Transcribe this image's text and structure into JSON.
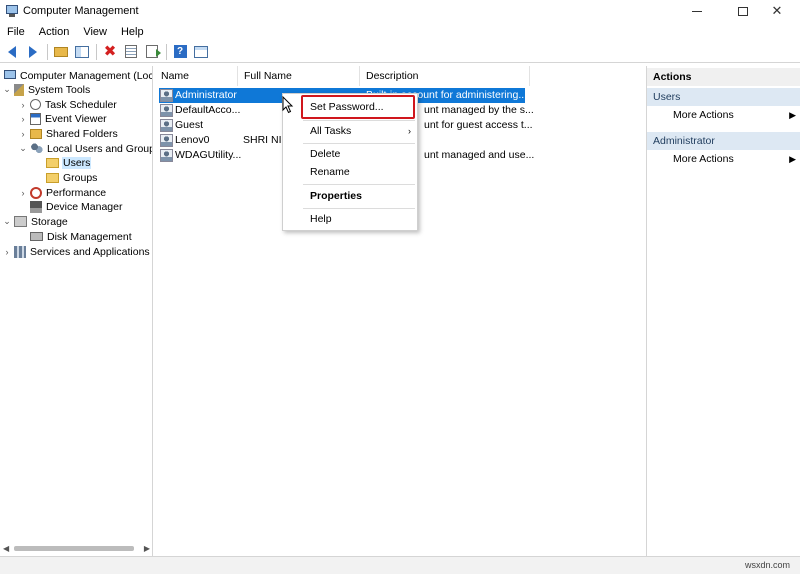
{
  "window": {
    "title": "Computer Management"
  },
  "menubar": {
    "items": [
      "File",
      "Action",
      "View",
      "Help"
    ]
  },
  "tree": {
    "root": "Computer Management (Local",
    "system_tools": "System Tools",
    "task_scheduler": "Task Scheduler",
    "event_viewer": "Event Viewer",
    "shared_folders": "Shared Folders",
    "local_users_groups": "Local Users and Groups",
    "users": "Users",
    "groups": "Groups",
    "performance": "Performance",
    "device_manager": "Device Manager",
    "storage": "Storage",
    "disk_management": "Disk Management",
    "services_apps": "Services and Applications"
  },
  "list": {
    "columns": [
      "Name",
      "Full Name",
      "Description"
    ],
    "rows": [
      {
        "name": "Administrator",
        "full_name": "",
        "description": "Built-in account for administering..."
      },
      {
        "name": "DefaultAcco...",
        "full_name": "",
        "description": "unt managed by the s..."
      },
      {
        "name": "Guest",
        "full_name": "",
        "description": "unt for guest access t..."
      },
      {
        "name": "Lenov0",
        "full_name": "SHRI NID",
        "description": ""
      },
      {
        "name": "WDAGUtility...",
        "full_name": "",
        "description": "unt managed and use..."
      }
    ]
  },
  "context_menu": {
    "set_password": "Set Password...",
    "all_tasks": "All Tasks",
    "delete": "Delete",
    "rename": "Rename",
    "properties": "Properties",
    "help": "Help"
  },
  "actions": {
    "header": "Actions",
    "users_section": "Users",
    "users_more": "More Actions",
    "admin_section": "Administrator",
    "admin_more": "More Actions"
  },
  "watermark": "wsxdn.com",
  "colors": {
    "selection": "#0f78d7",
    "highlight_box": "#d0171d",
    "section_bg": "#dde8f3"
  }
}
